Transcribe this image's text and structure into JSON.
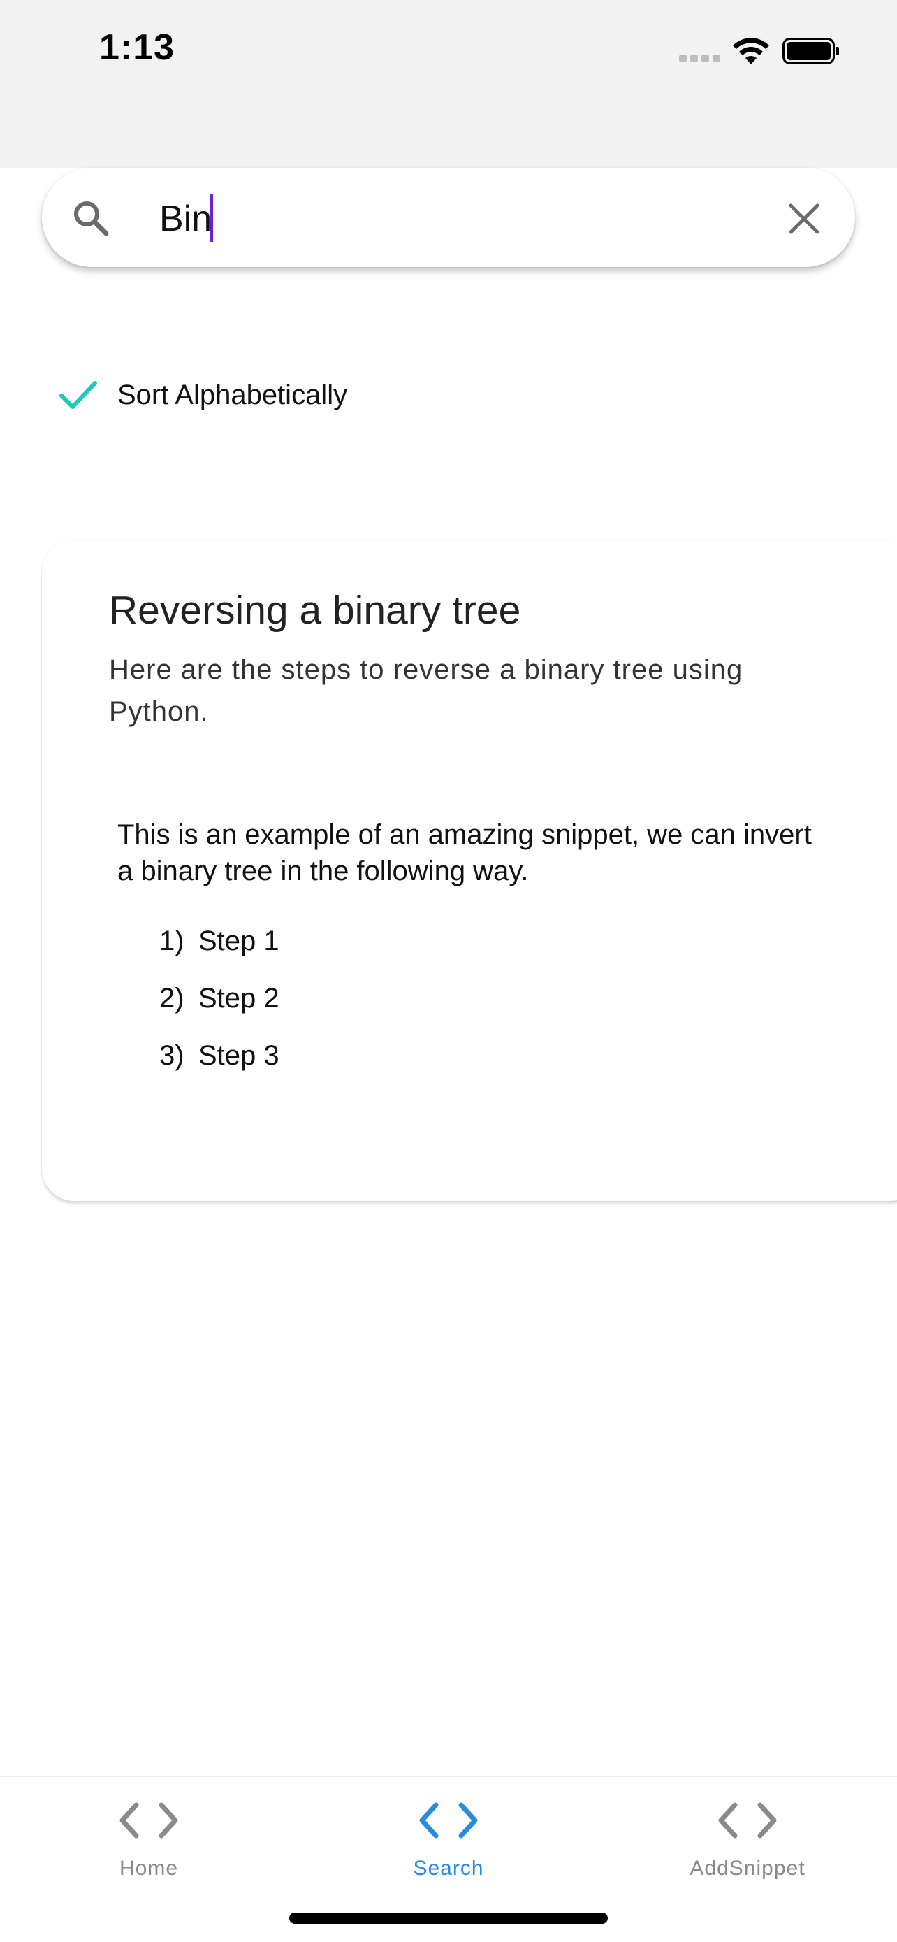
{
  "status_bar": {
    "time": "1:13"
  },
  "search": {
    "query": "Bin",
    "search_icon": "search-icon",
    "clear_icon": "close-icon"
  },
  "sort": {
    "checked": true,
    "label": "Sort Alphabetically",
    "check_color": "#1ec8b8"
  },
  "snippet_card": {
    "title": "Reversing a binary tree",
    "subtitle": "Here are the steps to reverse a binary tree using Python.",
    "body": "This is an example of an amazing snippet, we can invert a binary tree in the following way.",
    "steps": [
      {
        "number": "1)",
        "text": "Step 1"
      },
      {
        "number": "2)",
        "text": "Step 2"
      },
      {
        "number": "3)",
        "text": "Step 3"
      }
    ]
  },
  "tab_bar": {
    "active_color": "#2a8ae0",
    "inactive_color": "#8a8a8a",
    "tabs": [
      {
        "label": "Home",
        "icon": "code-icon",
        "active": false
      },
      {
        "label": "Search",
        "icon": "code-icon",
        "active": true
      },
      {
        "label": "AddSnippet",
        "icon": "code-icon",
        "active": false
      }
    ]
  },
  "caret_color": "#6a1fe0"
}
